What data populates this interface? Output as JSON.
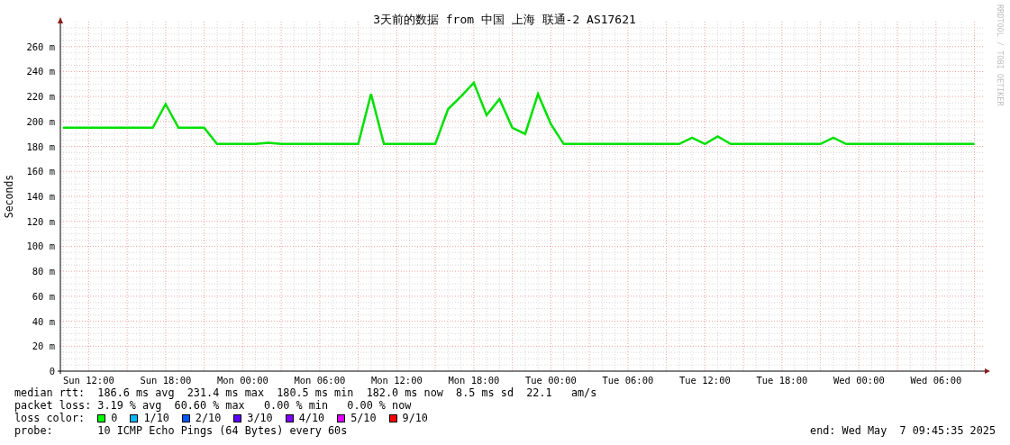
{
  "title": "3天前的数据 from 中国 上海 联通-2 AS17621",
  "credit": "RRDTOOL / TOBI OETIKER",
  "chart_data": {
    "type": "line",
    "grid": true,
    "ylabel": "Seconds",
    "ylim": [
      0,
      280
    ],
    "yticks": [
      {
        "value": 0,
        "label": "0"
      },
      {
        "value": 20,
        "label": "20 m"
      },
      {
        "value": 40,
        "label": "40 m"
      },
      {
        "value": 60,
        "label": "60 m"
      },
      {
        "value": 80,
        "label": "80 m"
      },
      {
        "value": 100,
        "label": "100 m"
      },
      {
        "value": 120,
        "label": "120 m"
      },
      {
        "value": 140,
        "label": "140 m"
      },
      {
        "value": 160,
        "label": "160 m"
      },
      {
        "value": 180,
        "label": "180 m"
      },
      {
        "value": 200,
        "label": "200 m"
      },
      {
        "value": 220,
        "label": "220 m"
      },
      {
        "value": 240,
        "label": "240 m"
      },
      {
        "value": 260,
        "label": "260 m"
      }
    ],
    "categories": [
      null,
      null,
      "Sun 12:00",
      null,
      null,
      null,
      null,
      null,
      "Sun 18:00",
      null,
      null,
      null,
      null,
      null,
      "Mon 00:00",
      null,
      null,
      null,
      null,
      null,
      "Mon 06:00",
      null,
      null,
      null,
      null,
      null,
      "Mon 12:00",
      null,
      null,
      null,
      null,
      null,
      "Mon 18:00",
      null,
      null,
      null,
      null,
      null,
      "Tue 00:00",
      null,
      null,
      null,
      null,
      null,
      "Tue 06:00",
      null,
      null,
      null,
      null,
      null,
      "Tue 12:00",
      null,
      null,
      null,
      null,
      null,
      "Tue 18:00",
      null,
      null,
      null,
      null,
      null,
      "Wed 00:00",
      null,
      null,
      null,
      null,
      null,
      "Wed 06:00",
      null,
      null,
      null
    ],
    "series": [
      {
        "color": "#00e000",
        "values": [
          195,
          195,
          195,
          195,
          195,
          195,
          195,
          195,
          214,
          195,
          195,
          195,
          182,
          182,
          182,
          182,
          183,
          182,
          182,
          182,
          182,
          182,
          182,
          182,
          222,
          182,
          182,
          182,
          182,
          182,
          210,
          220,
          231,
          205,
          218,
          195,
          190,
          222,
          198,
          182,
          182,
          182,
          182,
          182,
          182,
          182,
          182,
          182,
          182,
          187,
          182,
          188,
          182,
          182,
          182,
          182,
          182,
          182,
          182,
          182,
          187,
          182,
          182,
          182,
          182,
          182,
          182,
          182,
          182,
          182,
          182,
          182
        ]
      }
    ]
  },
  "stats": [
    {
      "label": "median rtt:",
      "text": "186.6 ms avg  231.4 ms max  180.5 ms min  182.0 ms now  8.5 ms sd  22.1   am/s"
    },
    {
      "label": "packet loss:",
      "text": "3.19 % avg  60.60 % max   0.00 % min   0.00 % now"
    }
  ],
  "loss_legend": {
    "label": "loss color:",
    "items": [
      {
        "label": "0",
        "color": "#00ff00"
      },
      {
        "label": "1/10",
        "color": "#00b8ff"
      },
      {
        "label": "2/10",
        "color": "#0059ff"
      },
      {
        "label": "3/10",
        "color": "#5e00ff"
      },
      {
        "label": "4/10",
        "color": "#7e00ff"
      },
      {
        "label": "5/10",
        "color": "#dd00ff"
      },
      {
        "label": "9/10",
        "color": "#ff0000"
      }
    ]
  },
  "probe": {
    "label": "probe:",
    "text": "10 ICMP Echo Pings (64 Bytes) every 60s"
  },
  "end": "end: Wed May  7 09:45:35 2025"
}
